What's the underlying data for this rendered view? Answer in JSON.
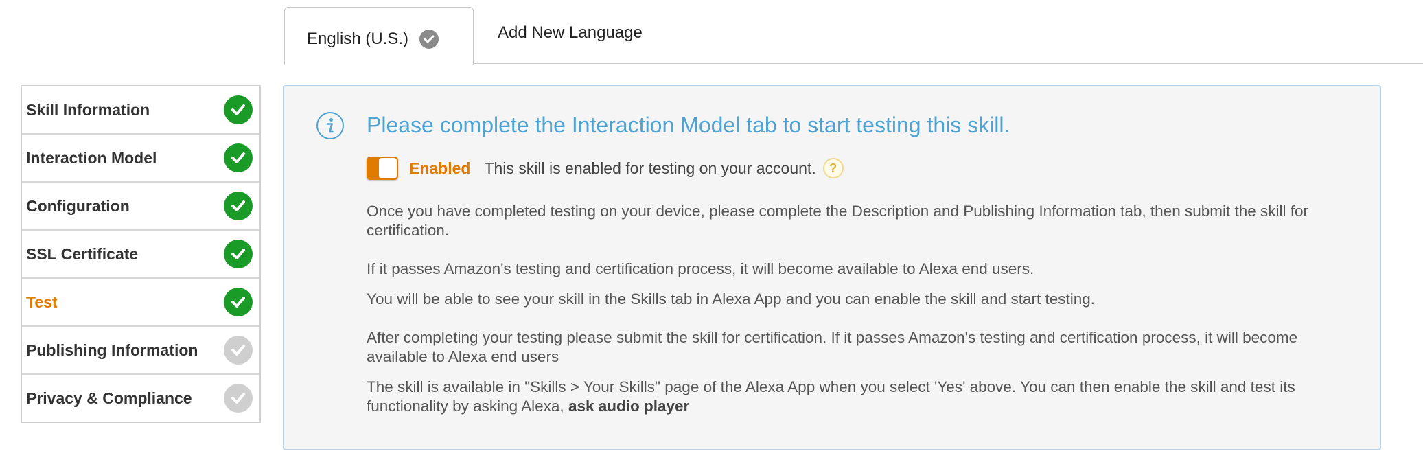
{
  "tabs": {
    "active_label": "English (U.S.)",
    "add_label": "Add New Language"
  },
  "side_nav": {
    "items": [
      {
        "label": "Skill Information",
        "status": "complete"
      },
      {
        "label": "Interaction Model",
        "status": "complete"
      },
      {
        "label": "Configuration",
        "status": "complete"
      },
      {
        "label": "SSL Certificate",
        "status": "complete"
      },
      {
        "label": "Test",
        "status": "complete",
        "active": true
      },
      {
        "label": "Publishing Information",
        "status": "incomplete"
      },
      {
        "label": "Privacy & Compliance",
        "status": "incomplete"
      }
    ]
  },
  "panel": {
    "title": "Please complete the Interaction Model tab to start testing this skill.",
    "toggle": {
      "state_label": "Enabled",
      "description": "This skill is enabled for testing on your account.",
      "help_glyph": "?"
    },
    "paragraphs": {
      "p1": "Once you have completed testing on your device, please complete the Description and Publishing Information tab, then submit the skill for certification.",
      "p2": "If it passes Amazon's testing and certification process, it will become available to Alexa end users.",
      "p3": "You will be able to see your skill in the Skills tab in Alexa App and you can enable the skill and start testing.",
      "p4": "After completing your testing please submit the skill for certification. If it passes Amazon's testing and certification process, it will become available to Alexa end users",
      "p5": "The skill is available in \"Skills > Your Skills\" page of the Alexa App when you select 'Yes' above. You can then enable the skill and test its functionality by asking Alexa,",
      "p5_invocation": "ask audio player"
    }
  },
  "colors": {
    "accent_orange": "#e07b00",
    "title_blue": "#4fa3d3",
    "complete_green": "#1a9b28",
    "incomplete_gray": "#cfcfcf",
    "panel_border": "#b9d3ea"
  },
  "icons": {
    "tab_status": "check-circle-icon",
    "nav_status": "check-circle-icon",
    "panel_info": "info-icon",
    "help": "question-mark-icon"
  }
}
